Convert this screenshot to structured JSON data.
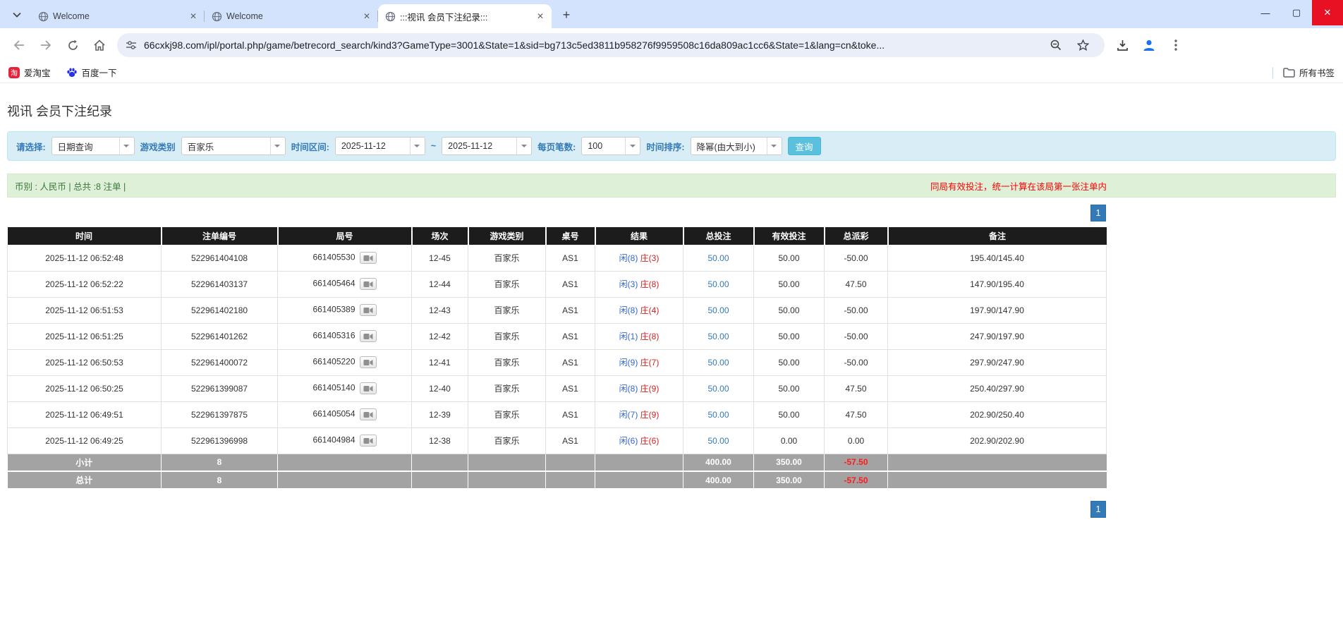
{
  "browser": {
    "window_controls": {
      "minimize": "—",
      "maximize": "▢",
      "close": "✕"
    },
    "tabs": [
      {
        "title": "Welcome"
      },
      {
        "title": "Welcome"
      },
      {
        "title": ":::视讯 会员下注纪录:::"
      }
    ],
    "new_tab": "+",
    "url": "66cxkj98.com/ipl/portal.php/game/betrecord_search/kind3?GameType=3001&State=1&sid=bg713c5ed3811b958276f9959508c16da809ac1cc6&State=1&lang=cn&toke...",
    "bookmarks": {
      "taobao_label": "爱淘宝",
      "taobao_glyph": "淘",
      "baidu_label": "百度一下",
      "all_label": "所有书签"
    }
  },
  "page": {
    "title": "视讯 会员下注纪录",
    "filters": {
      "select_label": "请选择:",
      "select_value": "日期查询",
      "game_label": "游戏类别",
      "game_value": "百家乐",
      "range_label": "时间区间:",
      "range_from": "2025-11-12",
      "range_separator": "~",
      "range_to": "2025-11-12",
      "page_size_label": "每页笔数:",
      "page_size_value": "100",
      "sort_label": "时间排序:",
      "sort_value": "降幂(由大到小)",
      "search_button": "查询"
    },
    "summary_bar": {
      "text": "币别 : 人民币 | 总共 :8 注单 |",
      "notice": "同局有效投注，统一计算在该局第一张注单内"
    },
    "pagination": {
      "current": "1"
    },
    "table": {
      "headers": [
        "时间",
        "注单编号",
        "局号",
        "场次",
        "游戏类别",
        "桌号",
        "结果",
        "总投注",
        "有效投注",
        "总派彩",
        "备注"
      ],
      "rows": [
        {
          "time": "2025-11-12 06:52:48",
          "bet_no": "522961404108",
          "round_no": "661405530",
          "session": "12-45",
          "game": "百家乐",
          "table_no": "AS1",
          "player": "闲(8)",
          "banker": "庄(3)",
          "total_bet": "50.00",
          "valid_bet": "50.00",
          "payout": "-50.00",
          "remark": "195.40/145.40"
        },
        {
          "time": "2025-11-12 06:52:22",
          "bet_no": "522961403137",
          "round_no": "661405464",
          "session": "12-44",
          "game": "百家乐",
          "table_no": "AS1",
          "player": "闲(3)",
          "banker": "庄(8)",
          "total_bet": "50.00",
          "valid_bet": "50.00",
          "payout": "47.50",
          "remark": "147.90/195.40"
        },
        {
          "time": "2025-11-12 06:51:53",
          "bet_no": "522961402180",
          "round_no": "661405389",
          "session": "12-43",
          "game": "百家乐",
          "table_no": "AS1",
          "player": "闲(8)",
          "banker": "庄(4)",
          "total_bet": "50.00",
          "valid_bet": "50.00",
          "payout": "-50.00",
          "remark": "197.90/147.90"
        },
        {
          "time": "2025-11-12 06:51:25",
          "bet_no": "522961401262",
          "round_no": "661405316",
          "session": "12-42",
          "game": "百家乐",
          "table_no": "AS1",
          "player": "闲(1)",
          "banker": "庄(8)",
          "total_bet": "50.00",
          "valid_bet": "50.00",
          "payout": "-50.00",
          "remark": "247.90/197.90"
        },
        {
          "time": "2025-11-12 06:50:53",
          "bet_no": "522961400072",
          "round_no": "661405220",
          "session": "12-41",
          "game": "百家乐",
          "table_no": "AS1",
          "player": "闲(9)",
          "banker": "庄(7)",
          "total_bet": "50.00",
          "valid_bet": "50.00",
          "payout": "-50.00",
          "remark": "297.90/247.90"
        },
        {
          "time": "2025-11-12 06:50:25",
          "bet_no": "522961399087",
          "round_no": "661405140",
          "session": "12-40",
          "game": "百家乐",
          "table_no": "AS1",
          "player": "闲(8)",
          "banker": "庄(9)",
          "total_bet": "50.00",
          "valid_bet": "50.00",
          "payout": "47.50",
          "remark": "250.40/297.90"
        },
        {
          "time": "2025-11-12 06:49:51",
          "bet_no": "522961397875",
          "round_no": "661405054",
          "session": "12-39",
          "game": "百家乐",
          "table_no": "AS1",
          "player": "闲(7)",
          "banker": "庄(9)",
          "total_bet": "50.00",
          "valid_bet": "50.00",
          "payout": "47.50",
          "remark": "202.90/250.40"
        },
        {
          "time": "2025-11-12 06:49:25",
          "bet_no": "522961396998",
          "round_no": "661404984",
          "session": "12-38",
          "game": "百家乐",
          "table_no": "AS1",
          "player": "闲(6)",
          "banker": "庄(6)",
          "total_bet": "50.00",
          "valid_bet": "0.00",
          "payout": "0.00",
          "remark": "202.90/202.90"
        }
      ],
      "subtotal": {
        "label": "小计",
        "count": "8",
        "total_bet": "400.00",
        "valid_bet": "350.00",
        "payout": "-57.50"
      },
      "total": {
        "label": "总计",
        "count": "8",
        "total_bet": "400.00",
        "valid_bet": "350.00",
        "payout": "-57.50"
      }
    }
  },
  "colors": {
    "accent_blue": "#337ab7",
    "search_button": "#5bc0de",
    "result_player_blue": "#3366cc",
    "result_banker_red": "#cc2222",
    "negative_red": "#ff0000",
    "header_black": "#1c1c1c",
    "footer_gray": "#a3a3a3",
    "tabbar_blue": "#d3e3fd"
  }
}
